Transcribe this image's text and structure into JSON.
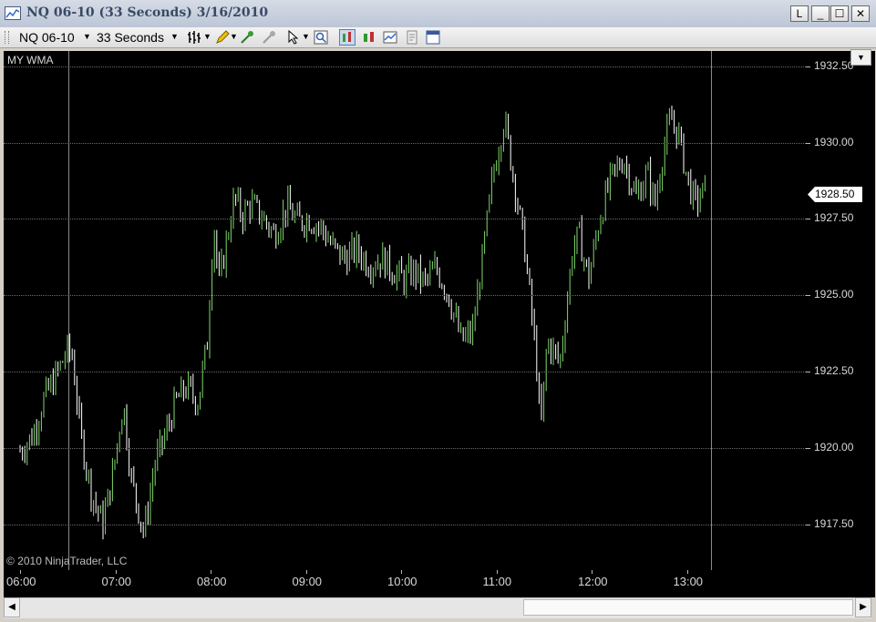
{
  "window": {
    "title": "NQ 06-10 (33 Seconds)  3/16/2010",
    "buttons": {
      "link": "L",
      "minimize": "_",
      "maximize": "☐",
      "close": "✕"
    }
  },
  "toolbar": {
    "instrument": "NQ 06-10",
    "interval": "33 Seconds",
    "icons": [
      "bar-type-icon",
      "drawing-pencil-icon",
      "add-indicator-icon",
      "remove-indicator-icon",
      "cursor-icon",
      "zoom-icon",
      "chart-style-icon",
      "candlestick-icon",
      "data-box-icon",
      "properties-icon",
      "panel-icon"
    ]
  },
  "chart": {
    "label": "MY WMA",
    "copyright": "© 2010 NinjaTrader, LLC",
    "last_price": "1928.50",
    "colors": {
      "background": "#000000",
      "up": "#7fd86a",
      "down": "#ffffff",
      "grid": "#6a6a6a"
    }
  },
  "chart_data": {
    "type": "line",
    "title": "",
    "xlabel": "",
    "ylabel": "",
    "y_ticks": [
      "1932.50",
      "1930.00",
      "1927.50",
      "1925.00",
      "1922.50",
      "1920.00",
      "1917.50"
    ],
    "x_ticks": [
      "06:00",
      "07:00",
      "08:00",
      "09:00",
      "10:00",
      "11:00",
      "12:00",
      "13:00"
    ],
    "ylim": [
      1916.0,
      1933.0
    ],
    "series": [
      {
        "x": [
          "06:00",
          "06:08",
          "06:15",
          "06:22",
          "06:30",
          "06:33",
          "06:38",
          "06:45",
          "06:52",
          "06:58",
          "07:05",
          "07:10",
          "07:18",
          "07:25",
          "07:32",
          "07:38",
          "07:45",
          "07:52",
          "07:58",
          "08:02",
          "08:05",
          "08:15",
          "08:20",
          "08:25",
          "08:32",
          "08:40",
          "08:48",
          "08:55",
          "09:02",
          "09:10",
          "09:18",
          "09:25",
          "09:32",
          "09:40",
          "09:48",
          "09:55",
          "10:02",
          "10:08",
          "10:15",
          "10:22",
          "10:30",
          "10:38",
          "10:45",
          "10:52",
          "10:58",
          "11:05",
          "11:12",
          "11:18",
          "11:25",
          "11:28",
          "11:32",
          "11:40",
          "11:45",
          "11:48",
          "11:52",
          "11:58",
          "12:05",
          "12:12",
          "12:20",
          "12:28",
          "12:35",
          "12:40",
          "12:45",
          "12:50",
          "12:55",
          "13:00",
          "13:05",
          "13:12"
        ],
        "values": [
          1919.9,
          1920.4,
          1921.6,
          1922.3,
          1923.2,
          1923.0,
          1920.5,
          1918.5,
          1917.5,
          1919.0,
          1921.5,
          1919.0,
          1917.2,
          1919.5,
          1920.5,
          1921.5,
          1922.0,
          1921.5,
          1923.5,
          1927.5,
          1925.3,
          1928.2,
          1927.6,
          1928.0,
          1927.6,
          1927.0,
          1927.9,
          1927.4,
          1927.5,
          1927.2,
          1926.5,
          1926.2,
          1926.5,
          1926.0,
          1926.2,
          1925.8,
          1925.5,
          1925.8,
          1925.4,
          1925.9,
          1925.0,
          1923.5,
          1923.8,
          1926.5,
          1929.0,
          1930.8,
          1928.5,
          1926.5,
          1923.0,
          1920.5,
          1923.5,
          1922.8,
          1925.0,
          1926.5,
          1927.0,
          1925.5,
          1927.5,
          1928.8,
          1929.5,
          1928.2,
          1929.0,
          1928.0,
          1929.7,
          1930.8,
          1930.2,
          1928.9,
          1928.0,
          1928.5
        ]
      }
    ],
    "grid": true,
    "legend": "none"
  }
}
